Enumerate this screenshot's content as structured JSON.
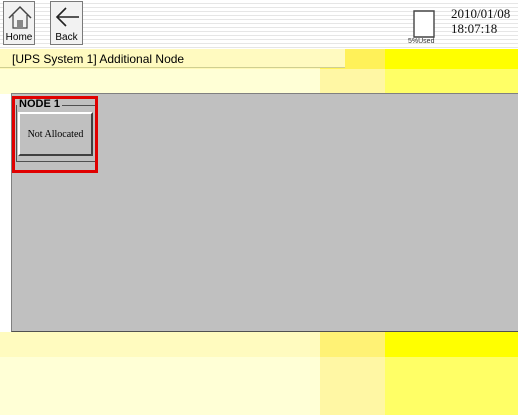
{
  "toolbar": {
    "home_label": "Home",
    "back_label": "Back",
    "storage_used": "5%Used",
    "date": "2010/01/08",
    "time": "18:07:18"
  },
  "header": {
    "title": "[UPS System 1] Additional Node"
  },
  "nodes": [
    {
      "group_label": "NODE 1",
      "button_label": "Not Allocated"
    }
  ],
  "colors": {
    "panel_gray": "#c0c0c0",
    "accent_yellow": "#ffff00",
    "highlight_red": "#e00000"
  },
  "icons": [
    "home-icon",
    "back-arrow-icon",
    "sd-card-icon"
  ]
}
